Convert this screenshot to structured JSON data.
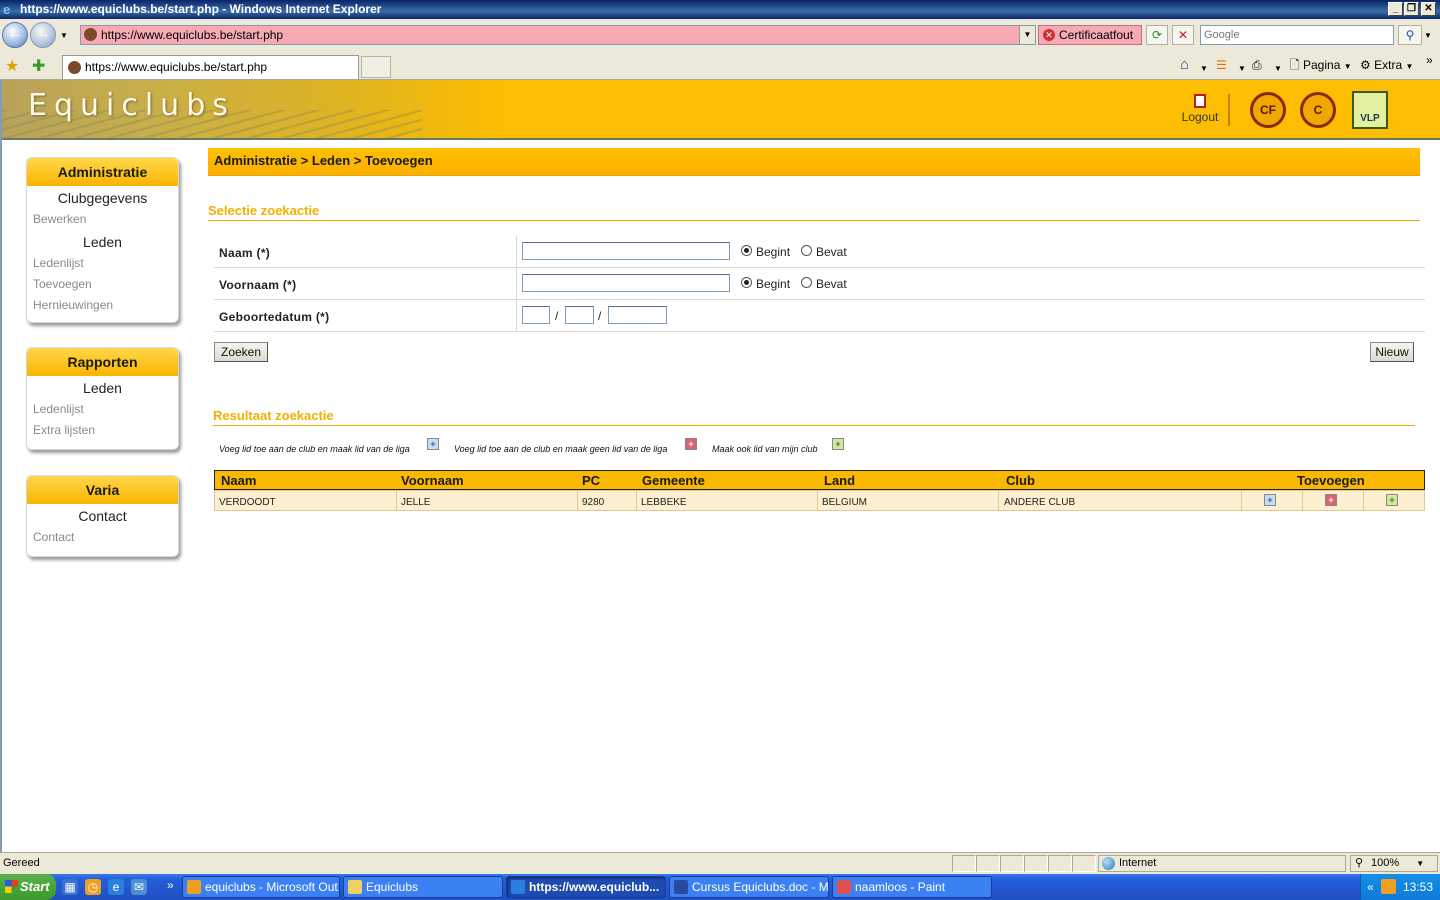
{
  "window": {
    "title": "https://www.equiclubs.be/start.php - Windows Internet Explorer"
  },
  "address_bar": {
    "url": "https://www.equiclubs.be/start.php",
    "cert_error": "Certificaatfout",
    "search_placeholder": "Google"
  },
  "tabs": [
    {
      "label": "https://www.equiclubs.be/start.php"
    }
  ],
  "commandbar": {
    "page_label": "Pagina",
    "extra_label": "Extra"
  },
  "banner": {
    "site_title": "Equiclubs",
    "logout_label": "Logout",
    "logo_vlp": "VLP"
  },
  "sidebar": {
    "administratie": {
      "title": "Administratie",
      "groups": [
        {
          "label": "Clubgegevens",
          "links": [
            "Bewerken"
          ]
        },
        {
          "label": "Leden",
          "links": [
            "Ledenlijst",
            "Toevoegen",
            "Hernieuwingen"
          ]
        }
      ]
    },
    "rapporten": {
      "title": "Rapporten",
      "groups": [
        {
          "label": "Leden",
          "links": [
            "Ledenlijst",
            "Extra lijsten"
          ]
        }
      ]
    },
    "varia": {
      "title": "Varia",
      "groups": [
        {
          "label": "Contact",
          "links": [
            "Contact"
          ]
        }
      ]
    }
  },
  "breadcrumb": "Administratie > Leden > Toevoegen",
  "search": {
    "title": "Selectie zoekactie",
    "fields": [
      {
        "label": "Naam (*)",
        "value": "",
        "radio_begint": "Begint",
        "radio_bevat": "Bevat",
        "selected": "Begint"
      },
      {
        "label": "Voornaam (*)",
        "value": "",
        "radio_begint": "Begint",
        "radio_bevat": "Bevat",
        "selected": "Begint"
      },
      {
        "label": "Geboortedatum (*)",
        "day": "",
        "month": "",
        "year": ""
      }
    ],
    "date_separator": "/",
    "search_button": "Zoeken",
    "new_button": "Nieuw"
  },
  "results": {
    "title": "Resultaat zoekactie",
    "legend": [
      {
        "text": "Voeg lid toe aan de club en maak lid van de liga",
        "icon": "add-blue-icon"
      },
      {
        "text": "Voeg lid toe aan de club en maak geen lid van de liga",
        "icon": "add-red-icon"
      },
      {
        "text": "Maak ook lid van mijn club",
        "icon": "add-green-icon"
      }
    ],
    "columns": [
      "Naam",
      "Voornaam",
      "PC",
      "Gemeente",
      "Land",
      "Club",
      "Toevoegen"
    ],
    "rows": [
      {
        "naam": "VERDOODT",
        "voornaam": "JELLE",
        "pc": "9280",
        "gemeente": "LEBBEKE",
        "land": "BELGIUM",
        "club": "ANDERE CLUB"
      }
    ]
  },
  "statusbar": {
    "status": "Gereed",
    "zone": "Internet",
    "zoom": "100%"
  },
  "taskbar": {
    "start_label": "Start",
    "tasks": [
      {
        "label": "equiclubs - Microsoft Out..."
      },
      {
        "label": "Equiclubs"
      },
      {
        "label": "https://www.equiclub..."
      },
      {
        "label": "Cursus Equiclubs.doc - M..."
      },
      {
        "label": "naamloos - Paint"
      }
    ],
    "clock": "13:53"
  },
  "colors": {
    "brand_yellow": "#fdbd00",
    "accent_text": "#f0b000",
    "cert_error_bg": "#f7aab4"
  }
}
